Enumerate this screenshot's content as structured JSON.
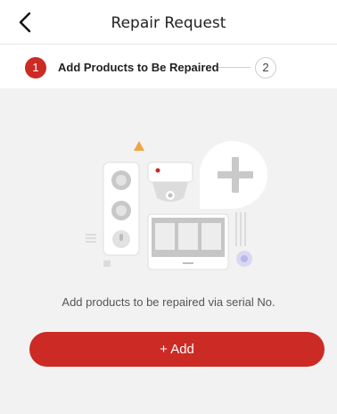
{
  "header": {
    "title": "Repair Request",
    "back_icon": "chevron-left-icon"
  },
  "steps": {
    "active": {
      "number": "1",
      "label": "Add Products to Be Repaired"
    },
    "next": {
      "number": "2"
    }
  },
  "empty_state": {
    "illustration_icon": "devices-illustration",
    "hint": "Add products to be repaired via serial No."
  },
  "actions": {
    "add_label": "+ Add"
  },
  "colors": {
    "accent": "#cc2a24",
    "triangle": "#f0a545",
    "disc": "#b9b6ea"
  }
}
